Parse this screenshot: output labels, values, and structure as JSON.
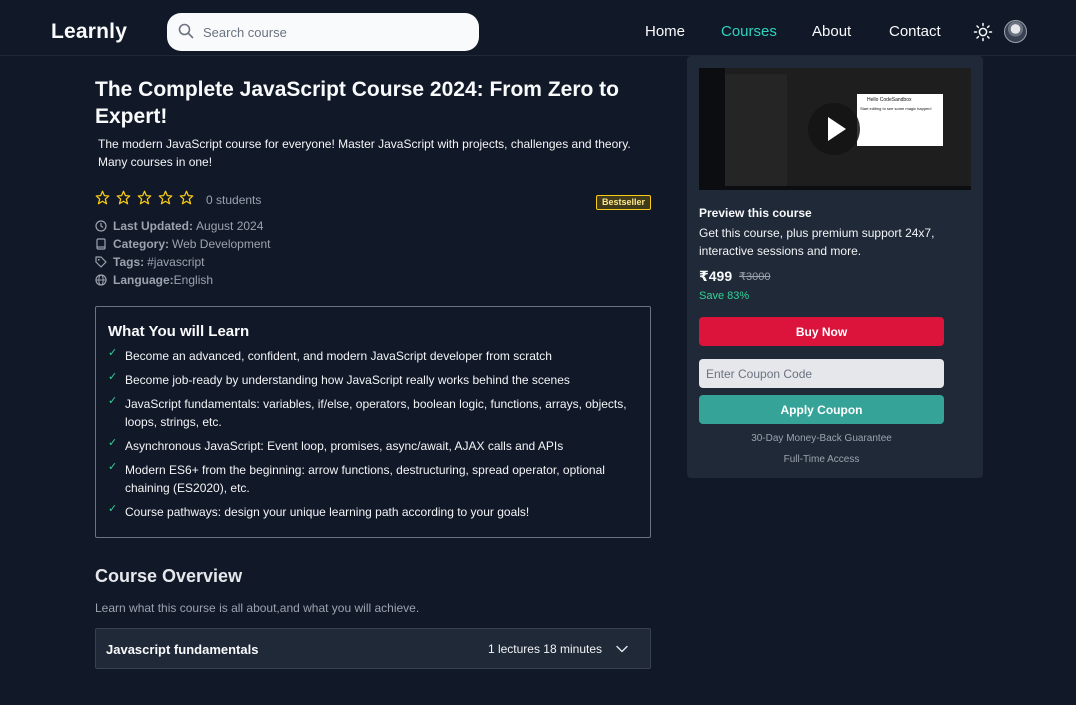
{
  "header": {
    "logo": "Learnly",
    "search_placeholder": "Search course",
    "nav": [
      "Home",
      "Courses",
      "About",
      "Contact"
    ],
    "active_nav": "Courses"
  },
  "course": {
    "title": "The Complete JavaScript Course 2024: From Zero to Expert!",
    "subtitle": "The modern JavaScript course for everyone! Master JavaScript with projects, challenges and theory. Many courses in one!",
    "rating_stars": 0,
    "students": "0 students",
    "badge": "Bestseller",
    "last_updated_label": "Last Updated:",
    "last_updated": "August 2024",
    "category_label": "Category:",
    "category": "Web Development",
    "tags_label": "Tags:",
    "tags": "#javascript",
    "language_label": "Language:",
    "language": "English"
  },
  "learn": {
    "title": "What You will Learn",
    "items": [
      "Become an advanced, confident, and modern JavaScript developer from scratch",
      "Become job-ready by understanding how JavaScript really works behind the scenes",
      "JavaScript fundamentals: variables, if/else, operators, boolean logic, functions, arrays, objects, loops, strings, etc.",
      "Asynchronous JavaScript: Event loop, promises, async/await, AJAX calls and APIs",
      "Modern ES6+ from the beginning: arrow functions, destructuring, spread operator, optional chaining (ES2020), etc.",
      "Course pathways: design your unique learning path according to your goals!"
    ]
  },
  "overview": {
    "title": "Course Overview",
    "subtitle": "Learn what this course is all about,and what you will achieve.",
    "sections": [
      {
        "title": "Javascript fundamentals",
        "meta": "1 lectures 18 minutes"
      }
    ]
  },
  "card": {
    "video_heading": "Hello CodeSandbox",
    "video_text": "Start editing to see some magic happen!",
    "preview_title": "Preview this course",
    "preview_desc": "Get this course, plus premium support 24x7, interactive sessions and more.",
    "price": "₹499",
    "old_price": "₹3000",
    "save": "Save 83%",
    "buy_label": "Buy Now",
    "coupon_placeholder": "Enter Coupon Code",
    "apply_label": "Apply Coupon",
    "guarantee": "30-Day Money-Back Guarantee",
    "access": "Full-Time Access"
  },
  "colors": {
    "background": "#111827",
    "accent_teal": "#35a398",
    "buy_red": "#dc143c",
    "star": "#facc15",
    "check_green": "#34d399"
  }
}
